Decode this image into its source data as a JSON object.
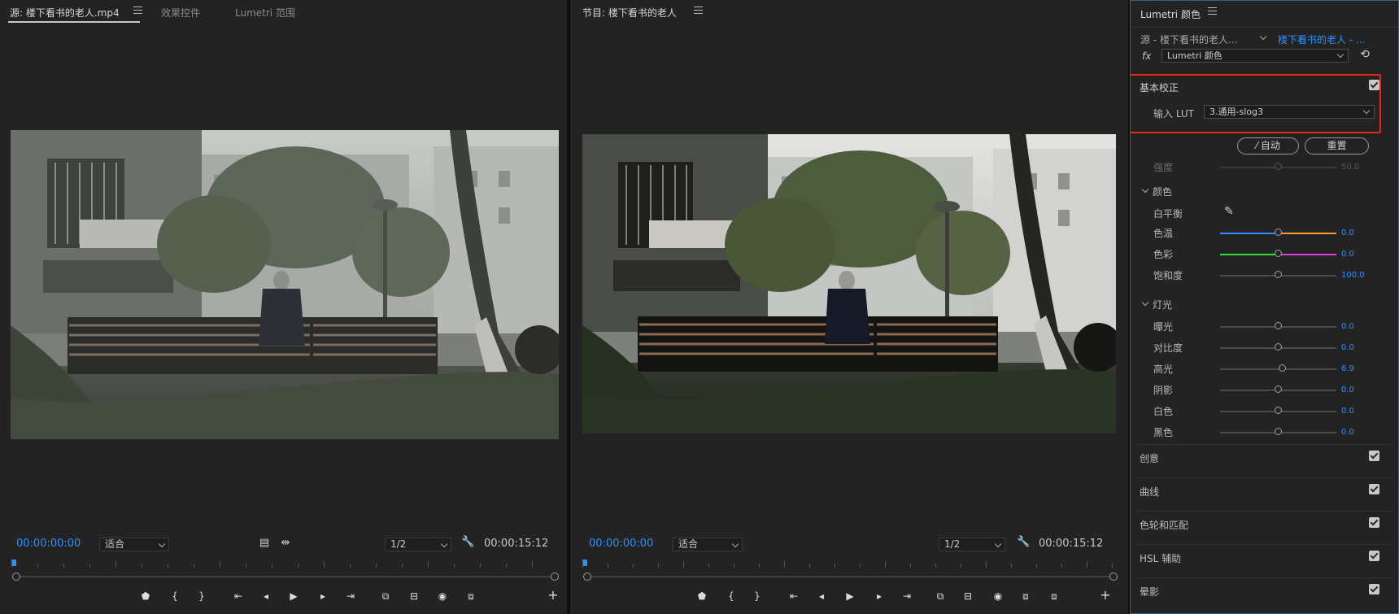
{
  "source_panel": {
    "tabs": [
      {
        "label": "源: 楼下看书的老人.mp4",
        "active": true
      },
      {
        "label": "效果控件",
        "active": false
      },
      {
        "label": "Lumetri 范围",
        "active": false
      }
    ],
    "timecode_current": "00:00:00:00",
    "fit_label": "适合",
    "resolution_label": "1/2",
    "timecode_duration": "00:00:15:12"
  },
  "program_panel": {
    "title": "节目: 楼下看书的老人",
    "timecode_current": "00:00:00:00",
    "fit_label": "适合",
    "resolution_label": "1/2",
    "timecode_duration": "00:00:15:12"
  },
  "lumetri": {
    "title": "Lumetri 颜色",
    "source_clip": "源 - 楼下看书的老人...",
    "target_clip": "楼下看书的老人 - ...",
    "fx_label": "fx",
    "effect_name": "Lumetri 颜色",
    "basic": {
      "title": "基本校正",
      "enabled": true,
      "input_lut_label": "输入 LUT",
      "input_lut_value": "3.通用-slog3",
      "auto_label": "自动",
      "reset_label": "重置",
      "intensity_label": "强度",
      "intensity_value": "50.0",
      "color_section": "颜色",
      "white_balance_label": "白平衡",
      "sliders_color": [
        {
          "label": "色温",
          "value": "0.0",
          "pos": 0.5
        },
        {
          "label": "色彩",
          "value": "0.0",
          "pos": 0.5
        },
        {
          "label": "饱和度",
          "value": "100.0",
          "pos": 0.5
        }
      ],
      "light_section": "灯光",
      "sliders_light": [
        {
          "label": "曝光",
          "value": "0.0",
          "pos": 0.5
        },
        {
          "label": "对比度",
          "value": "0.0",
          "pos": 0.5
        },
        {
          "label": "高光",
          "value": "6.9",
          "pos": 0.535
        },
        {
          "label": "阴影",
          "value": "0.0",
          "pos": 0.5
        },
        {
          "label": "白色",
          "value": "0.0",
          "pos": 0.5
        },
        {
          "label": "黑色",
          "value": "0.0",
          "pos": 0.5
        }
      ]
    },
    "sections": [
      {
        "label": "创意",
        "enabled": true
      },
      {
        "label": "曲线",
        "enabled": true
      },
      {
        "label": "色轮和匹配",
        "enabled": true
      },
      {
        "label": "HSL 辅助",
        "enabled": true
      },
      {
        "label": "晕影",
        "enabled": true
      }
    ]
  },
  "colors": {
    "accent": "#2f8fff",
    "highlight_box": "#e02a20",
    "panel_bg": "#232323",
    "temp_left": "#3a8bff",
    "temp_right": "#ff9a2e",
    "tint_left": "#30e040",
    "tint_right": "#e03ce0"
  }
}
